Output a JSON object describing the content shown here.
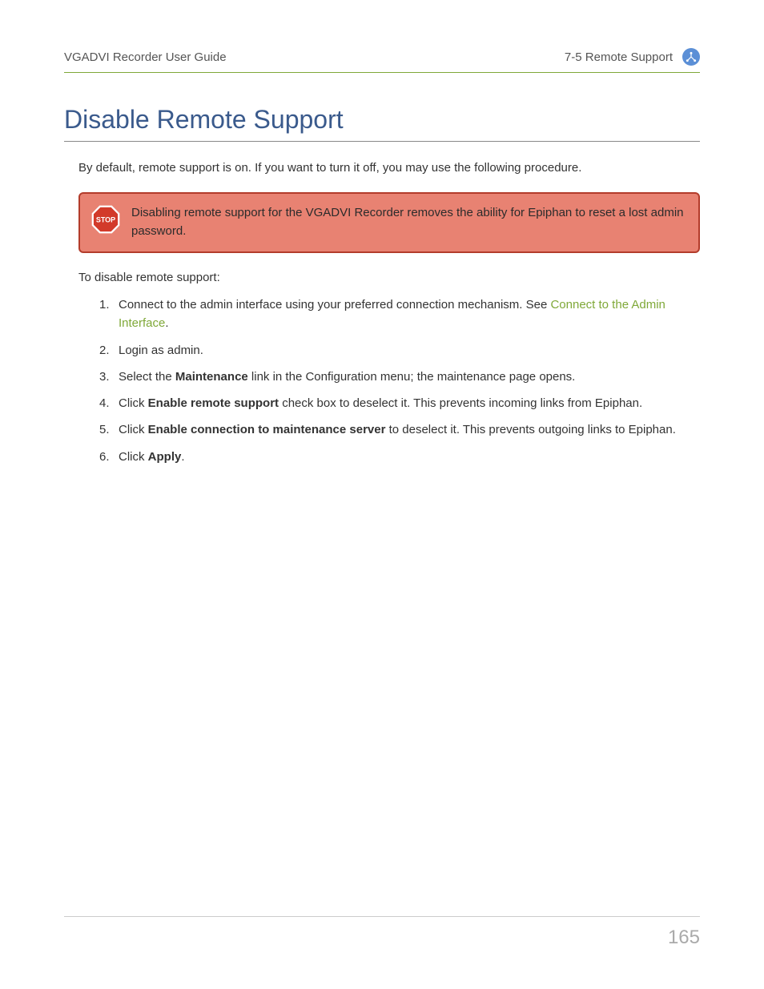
{
  "header": {
    "left": "VGADVI Recorder User Guide",
    "right": "7-5 Remote Support"
  },
  "title": "Disable Remote Support",
  "intro": "By default, remote support is on. If you want to turn it off, you may use the following procedure.",
  "callout": {
    "icon_label": "STOP",
    "text": "Disabling remote support for the VGADVI Recorder removes the ability for Epiphan to reset a lost admin password."
  },
  "procedure_lead": "To disable remote support:",
  "steps": [
    {
      "prefix": "Connect to the admin interface using your preferred connection mechanism. See ",
      "link": "Connect to the Admin Interface",
      "suffix": "."
    },
    {
      "text": "Login as admin."
    },
    {
      "prefix": "Select the ",
      "bold1": "Maintenance",
      "mid": " link in the Configuration menu; the maintenance page opens.",
      "suffix": ""
    },
    {
      "prefix": "Click ",
      "bold1": "Enable remote support",
      "mid": " check box to deselect it. This prevents incoming links from Epiphan.",
      "suffix": ""
    },
    {
      "prefix": "Click ",
      "bold1": "Enable connection to maintenance server",
      "mid": " to deselect it. This prevents outgoing links to Epiphan.",
      "suffix": ""
    },
    {
      "prefix": "Click ",
      "bold1": "Apply",
      "mid": ".",
      "suffix": ""
    }
  ],
  "page_number": "165"
}
